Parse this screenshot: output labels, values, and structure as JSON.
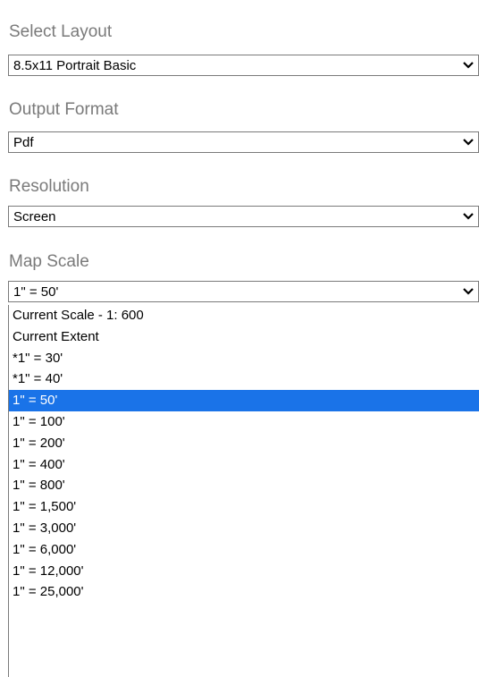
{
  "layout": {
    "label": "Select Layout",
    "value": "8.5x11 Portrait Basic"
  },
  "output_format": {
    "label": "Output Format",
    "value": "Pdf"
  },
  "resolution": {
    "label": "Resolution",
    "value": "Screen"
  },
  "map_scale": {
    "label": "Map Scale",
    "value": "1\" = 50'",
    "options": [
      "Current Scale - 1: 600",
      "Current Extent",
      "*1\" = 30'",
      "*1\" = 40'",
      "1\" = 50'",
      "1\" = 100'",
      "1\" = 200'",
      "1\" = 400'",
      "1\" = 800'",
      "1\" = 1,500'",
      "1\" = 3,000'",
      "1\" = 6,000'",
      "1\" = 12,000'",
      "1\" = 25,000'"
    ],
    "selected_index": 4
  },
  "icons": {
    "dropdown": "chevron-down-icon"
  },
  "colors": {
    "selection_bg": "#1a73e8",
    "label_text": "#7a7a7a",
    "border": "#7a7a7a"
  }
}
